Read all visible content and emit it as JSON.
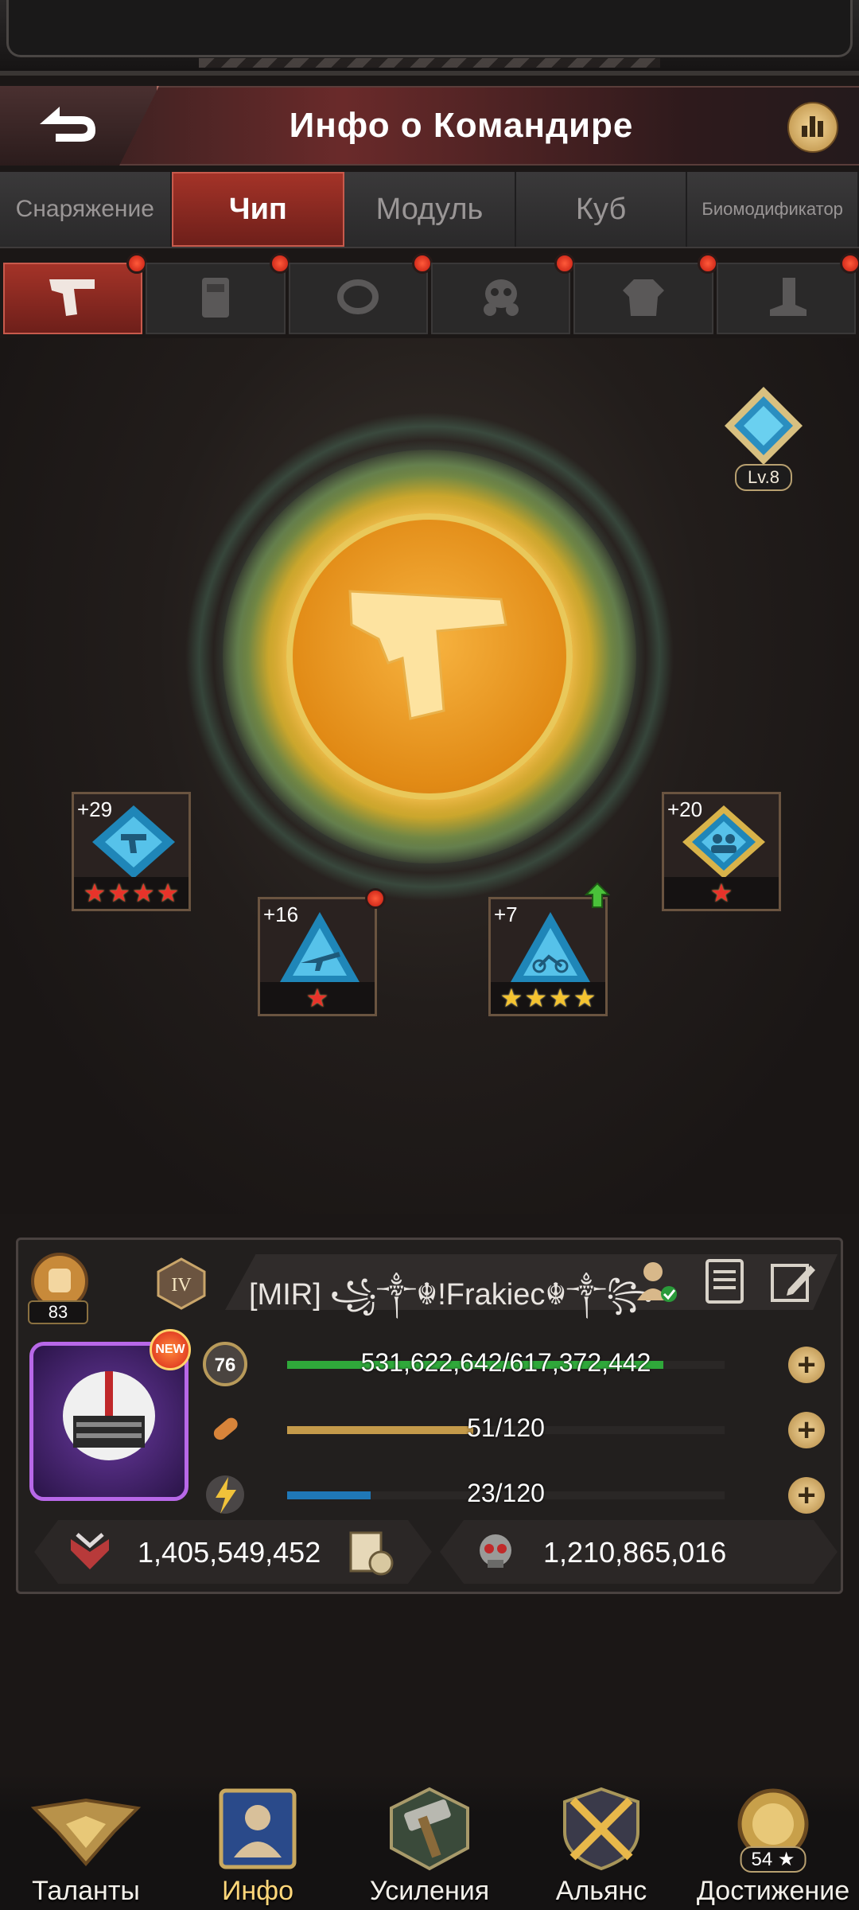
{
  "header": {
    "title": "Инфо о Командире",
    "back_icon": "back-arrow-icon",
    "stats_icon": "bar-chart-icon"
  },
  "tabs": [
    {
      "label": "Снаряжение",
      "active": false
    },
    {
      "label": "Чип",
      "active": true
    },
    {
      "label": "Модуль",
      "active": false
    },
    {
      "label": "Куб",
      "active": false
    },
    {
      "label": "Биомодификатор",
      "active": false
    }
  ],
  "gear_slots": [
    {
      "icon": "pistol-icon",
      "active": true,
      "notification": true
    },
    {
      "icon": "vest-icon",
      "active": false,
      "notification": true
    },
    {
      "icon": "ring-icon",
      "active": false,
      "notification": true
    },
    {
      "icon": "gas-mask-icon",
      "active": false,
      "notification": true
    },
    {
      "icon": "jacket-icon",
      "active": false,
      "notification": true
    },
    {
      "icon": "boot-icon",
      "active": false,
      "notification": true
    }
  ],
  "main": {
    "center_icon": "pistol-icon",
    "level_label": "Lv.8",
    "chips": [
      {
        "id": "chip-1",
        "plus": "+29",
        "stars": 4,
        "star_color": "red",
        "icon": "gun-icon",
        "notification": false,
        "upgrade": false
      },
      {
        "id": "chip-2",
        "plus": "+16",
        "stars": 1,
        "star_color": "red",
        "icon": "rifle-icon",
        "notification": true,
        "upgrade": false
      },
      {
        "id": "chip-3",
        "plus": "+7",
        "stars": 4,
        "star_color": "gold",
        "icon": "motorcycle-icon",
        "notification": false,
        "upgrade": true
      },
      {
        "id": "chip-4",
        "plus": "+20",
        "stars": 1,
        "star_color": "red",
        "icon": "group-icon",
        "notification": false,
        "upgrade": false
      }
    ]
  },
  "commander": {
    "rank_level": "83",
    "tier": "IV",
    "name": "[MIR]  ꧁༒☬!Frakiec☬༒꧂",
    "level": "76",
    "new_badge": "NEW",
    "stats": [
      {
        "label": "531,622,642/617,372,442",
        "fill": 0.86,
        "color": "#2fa83a",
        "icon": "experience-icon"
      },
      {
        "label": "51/120",
        "fill": 0.425,
        "color": "#c49a4a",
        "icon": "bullet-icon"
      },
      {
        "label": "23/120",
        "fill": 0.19,
        "color": "#1f78b8",
        "icon": "energy-icon"
      }
    ],
    "power": "1,405,549,452",
    "kills": "1,210,865,016"
  },
  "bottom_nav": [
    {
      "label": "Таланты",
      "icon": "talent-wings-icon",
      "active": false
    },
    {
      "label": "Инфо",
      "icon": "commander-info-icon",
      "active": true
    },
    {
      "label": "Усиления",
      "icon": "hammer-icon",
      "active": false
    },
    {
      "label": "Альянс",
      "icon": "crossed-swords-icon",
      "active": false
    },
    {
      "label": "Достижение",
      "icon": "lion-trophy-icon",
      "active": false,
      "count": "54 ★"
    }
  ]
}
